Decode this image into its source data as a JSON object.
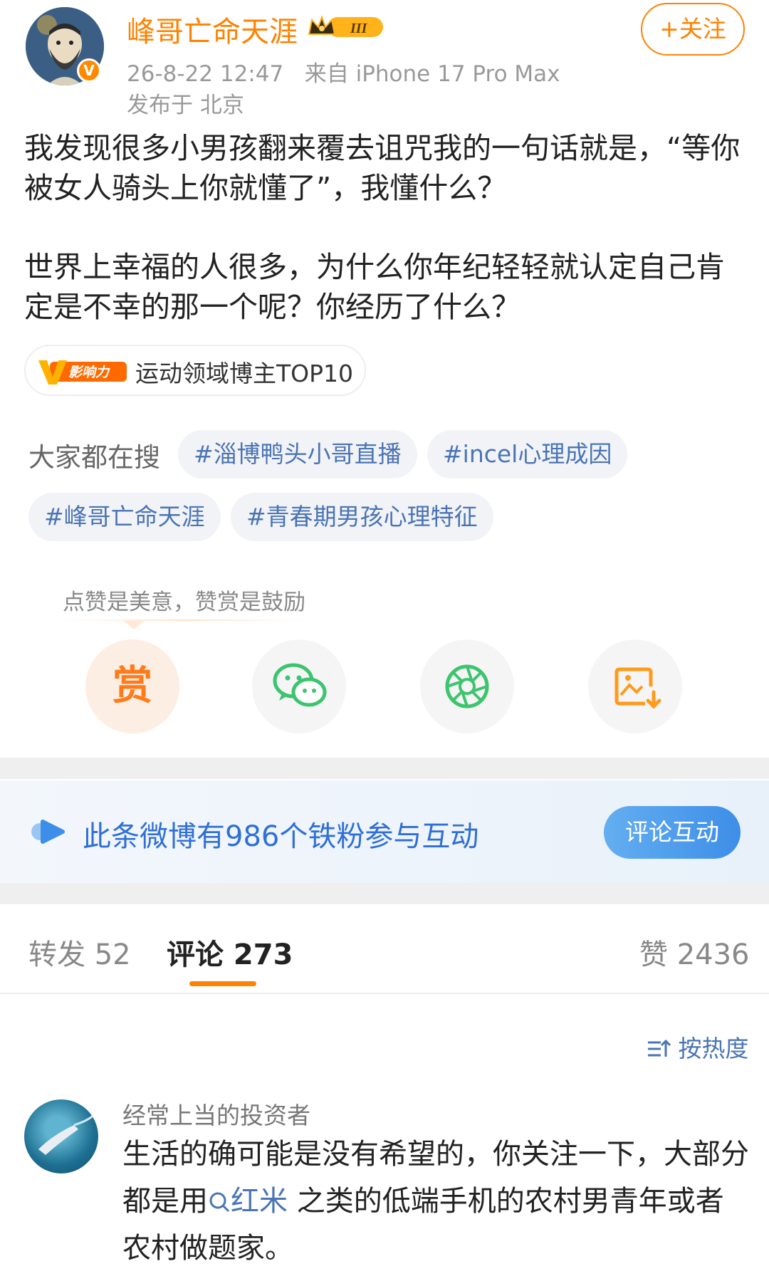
{
  "post": {
    "author": "峰哥亡命天涯",
    "level_badge": "III",
    "verified_badge": "V",
    "time": "26-8-22 12:47",
    "source": "来自 iPhone 17 Pro Max",
    "location": "发布于 北京",
    "follow_label": "+关注",
    "paragraph1": "我发现很多小男孩翻来覆去诅咒我的一句话就是，“等你被女人骑头上你就懂了”，我懂什么？",
    "paragraph2": "世界上幸福的人很多，为什么你年纪轻轻就认定自己肯定是不幸的那一个呢？你经历了什么？",
    "influence_badge": "影响力",
    "influence_text": "运动领域博主TOP10"
  },
  "hot_search": {
    "label": "大家都在搜",
    "tags": [
      "#淄博鸭头小哥直播",
      "#incel心理成因",
      "#峰哥亡命天涯",
      "#青春期男孩心理特征"
    ]
  },
  "reward": {
    "hint": "点赞是美意，赞赏是鼓励",
    "reward_glyph": "赏",
    "actions": [
      "reward-icon",
      "wechat-icon",
      "moments-icon",
      "save-image-icon"
    ]
  },
  "fan_banner": {
    "text": "此条微博有986个铁粉参与互动",
    "button": "评论互动"
  },
  "tabs": {
    "repost_label": "转发 52",
    "comment_label": "评论 273",
    "like_label": "赞 2436"
  },
  "sort": {
    "label": "按热度"
  },
  "comment": {
    "user": "经常上当的投资者",
    "text_before": "生活的确可能是没有希望的，你关注一下，大部分都是用",
    "link_text": "红米",
    "text_after": " 之类的低端手机的农村男青年或者农村做题家。"
  },
  "colors": {
    "accent": "#ff8200",
    "link": "#4a74b5",
    "banner_blue": "#2f6fd6"
  }
}
